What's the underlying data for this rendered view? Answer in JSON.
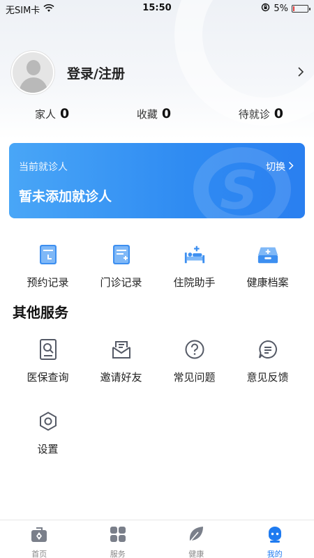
{
  "status_bar": {
    "carrier": "无SIM卡",
    "time": "15:50",
    "battery": "5%"
  },
  "profile": {
    "login_label": "登录/注册"
  },
  "stats": [
    {
      "label": "家人",
      "value": "0"
    },
    {
      "label": "收藏",
      "value": "0"
    },
    {
      "label": "待就诊",
      "value": "0"
    }
  ],
  "patient_card": {
    "label": "当前就诊人",
    "switch_label": "切换",
    "empty_text": "暂未添加就诊人",
    "accent": "#2f8bf2"
  },
  "records": [
    {
      "label": "预约记录",
      "icon": "appointment-record-icon"
    },
    {
      "label": "门诊记录",
      "icon": "outpatient-record-icon"
    },
    {
      "label": "住院助手",
      "icon": "hospital-bed-icon"
    },
    {
      "label": "健康档案",
      "icon": "health-archive-icon"
    }
  ],
  "other_services": {
    "title": "其他服务",
    "items": [
      {
        "label": "医保查询",
        "icon": "insurance-query-icon"
      },
      {
        "label": "邀请好友",
        "icon": "invite-mail-icon"
      },
      {
        "label": "常见问题",
        "icon": "question-icon"
      },
      {
        "label": "意见反馈",
        "icon": "feedback-icon"
      },
      {
        "label": "设置",
        "icon": "settings-hex-icon"
      }
    ]
  },
  "tabbar": [
    {
      "label": "首页",
      "icon": "home-medkit-icon"
    },
    {
      "label": "服务",
      "icon": "service-grid-icon"
    },
    {
      "label": "健康",
      "icon": "leaf-icon"
    },
    {
      "label": "我的",
      "icon": "robot-avatar-icon",
      "active": true
    }
  ],
  "colors": {
    "primary": "#1f7bf0",
    "icon_gray": "#555a66"
  }
}
